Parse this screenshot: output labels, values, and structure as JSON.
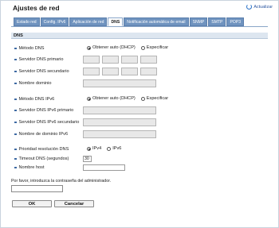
{
  "header": {
    "title": "Ajustes de red",
    "refresh_label": "Actualizar"
  },
  "tabs": [
    {
      "label": "Estado red",
      "active": false
    },
    {
      "label": "Config. IPv6",
      "active": false
    },
    {
      "label": "Aplicación de red",
      "active": false
    },
    {
      "label": "DNS",
      "active": true
    },
    {
      "label": "Notificación automática de email",
      "active": false
    },
    {
      "label": "SNMP",
      "active": false
    },
    {
      "label": "SMTP",
      "active": false
    },
    {
      "label": "POP3",
      "active": false
    }
  ],
  "section": {
    "title": "DNS"
  },
  "dns": {
    "method_label": "Método DNS",
    "method_options": [
      "Obtener auto (DHCP)",
      "Especificar"
    ],
    "method_selected": "Obtener auto (DHCP)",
    "primary_label": "Servidor DNS primario",
    "secondary_label": "Servidor DNS secundario",
    "domain_label": "Nombre dominio"
  },
  "dns_ipv6": {
    "method_label": "Método DNS IPv6",
    "method_options": [
      "Obtener auto (DHCP)",
      "Especificar"
    ],
    "method_selected": "Obtener auto (DHCP)",
    "primary_label": "Servidor DNS IPv6 primario",
    "secondary_label": "Servidor DNS IPv6 secundario",
    "domain_label": "Nombre de dominio IPv6"
  },
  "resolution": {
    "priority_label": "Prioridad resolución DNS",
    "priority_options": [
      "IPv4",
      "IPv6"
    ],
    "priority_selected": "IPv4",
    "timeout_label": "Timeout DNS (segundos)",
    "timeout_value": "30",
    "host_label": "Nombre host",
    "host_value": ""
  },
  "footer": {
    "password_prompt": "Por favor, introduzca la contraseña del administrador.",
    "password_value": "",
    "ok_label": "OK",
    "cancel_label": "Cancelar"
  },
  "colors": {
    "tab_bg": "#6f93bf",
    "section_bg": "#dde6f0",
    "bullet": "#3e6aa3"
  }
}
